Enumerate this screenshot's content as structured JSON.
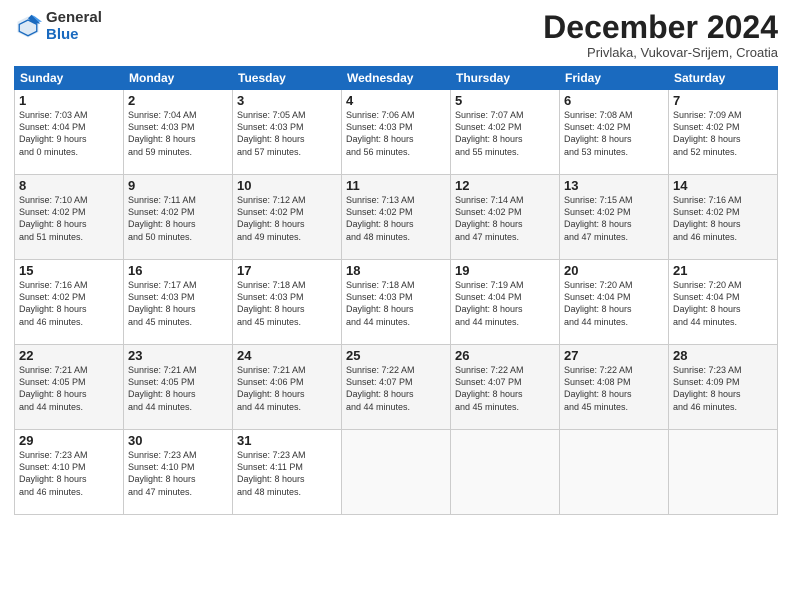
{
  "logo": {
    "general": "General",
    "blue": "Blue"
  },
  "header": {
    "title": "December 2024",
    "subtitle": "Privlaka, Vukovar-Srijem, Croatia"
  },
  "weekdays": [
    "Sunday",
    "Monday",
    "Tuesday",
    "Wednesday",
    "Thursday",
    "Friday",
    "Saturday"
  ],
  "weeks": [
    [
      {
        "day": "1",
        "info": "Sunrise: 7:03 AM\nSunset: 4:04 PM\nDaylight: 9 hours\nand 0 minutes."
      },
      {
        "day": "2",
        "info": "Sunrise: 7:04 AM\nSunset: 4:03 PM\nDaylight: 8 hours\nand 59 minutes."
      },
      {
        "day": "3",
        "info": "Sunrise: 7:05 AM\nSunset: 4:03 PM\nDaylight: 8 hours\nand 57 minutes."
      },
      {
        "day": "4",
        "info": "Sunrise: 7:06 AM\nSunset: 4:03 PM\nDaylight: 8 hours\nand 56 minutes."
      },
      {
        "day": "5",
        "info": "Sunrise: 7:07 AM\nSunset: 4:02 PM\nDaylight: 8 hours\nand 55 minutes."
      },
      {
        "day": "6",
        "info": "Sunrise: 7:08 AM\nSunset: 4:02 PM\nDaylight: 8 hours\nand 53 minutes."
      },
      {
        "day": "7",
        "info": "Sunrise: 7:09 AM\nSunset: 4:02 PM\nDaylight: 8 hours\nand 52 minutes."
      }
    ],
    [
      {
        "day": "8",
        "info": "Sunrise: 7:10 AM\nSunset: 4:02 PM\nDaylight: 8 hours\nand 51 minutes."
      },
      {
        "day": "9",
        "info": "Sunrise: 7:11 AM\nSunset: 4:02 PM\nDaylight: 8 hours\nand 50 minutes."
      },
      {
        "day": "10",
        "info": "Sunrise: 7:12 AM\nSunset: 4:02 PM\nDaylight: 8 hours\nand 49 minutes."
      },
      {
        "day": "11",
        "info": "Sunrise: 7:13 AM\nSunset: 4:02 PM\nDaylight: 8 hours\nand 48 minutes."
      },
      {
        "day": "12",
        "info": "Sunrise: 7:14 AM\nSunset: 4:02 PM\nDaylight: 8 hours\nand 47 minutes."
      },
      {
        "day": "13",
        "info": "Sunrise: 7:15 AM\nSunset: 4:02 PM\nDaylight: 8 hours\nand 47 minutes."
      },
      {
        "day": "14",
        "info": "Sunrise: 7:16 AM\nSunset: 4:02 PM\nDaylight: 8 hours\nand 46 minutes."
      }
    ],
    [
      {
        "day": "15",
        "info": "Sunrise: 7:16 AM\nSunset: 4:02 PM\nDaylight: 8 hours\nand 46 minutes."
      },
      {
        "day": "16",
        "info": "Sunrise: 7:17 AM\nSunset: 4:03 PM\nDaylight: 8 hours\nand 45 minutes."
      },
      {
        "day": "17",
        "info": "Sunrise: 7:18 AM\nSunset: 4:03 PM\nDaylight: 8 hours\nand 45 minutes."
      },
      {
        "day": "18",
        "info": "Sunrise: 7:18 AM\nSunset: 4:03 PM\nDaylight: 8 hours\nand 44 minutes."
      },
      {
        "day": "19",
        "info": "Sunrise: 7:19 AM\nSunset: 4:04 PM\nDaylight: 8 hours\nand 44 minutes."
      },
      {
        "day": "20",
        "info": "Sunrise: 7:20 AM\nSunset: 4:04 PM\nDaylight: 8 hours\nand 44 minutes."
      },
      {
        "day": "21",
        "info": "Sunrise: 7:20 AM\nSunset: 4:04 PM\nDaylight: 8 hours\nand 44 minutes."
      }
    ],
    [
      {
        "day": "22",
        "info": "Sunrise: 7:21 AM\nSunset: 4:05 PM\nDaylight: 8 hours\nand 44 minutes."
      },
      {
        "day": "23",
        "info": "Sunrise: 7:21 AM\nSunset: 4:05 PM\nDaylight: 8 hours\nand 44 minutes."
      },
      {
        "day": "24",
        "info": "Sunrise: 7:21 AM\nSunset: 4:06 PM\nDaylight: 8 hours\nand 44 minutes."
      },
      {
        "day": "25",
        "info": "Sunrise: 7:22 AM\nSunset: 4:07 PM\nDaylight: 8 hours\nand 44 minutes."
      },
      {
        "day": "26",
        "info": "Sunrise: 7:22 AM\nSunset: 4:07 PM\nDaylight: 8 hours\nand 45 minutes."
      },
      {
        "day": "27",
        "info": "Sunrise: 7:22 AM\nSunset: 4:08 PM\nDaylight: 8 hours\nand 45 minutes."
      },
      {
        "day": "28",
        "info": "Sunrise: 7:23 AM\nSunset: 4:09 PM\nDaylight: 8 hours\nand 46 minutes."
      }
    ],
    [
      {
        "day": "29",
        "info": "Sunrise: 7:23 AM\nSunset: 4:10 PM\nDaylight: 8 hours\nand 46 minutes."
      },
      {
        "day": "30",
        "info": "Sunrise: 7:23 AM\nSunset: 4:10 PM\nDaylight: 8 hours\nand 47 minutes."
      },
      {
        "day": "31",
        "info": "Sunrise: 7:23 AM\nSunset: 4:11 PM\nDaylight: 8 hours\nand 48 minutes."
      },
      {
        "day": "",
        "info": ""
      },
      {
        "day": "",
        "info": ""
      },
      {
        "day": "",
        "info": ""
      },
      {
        "day": "",
        "info": ""
      }
    ]
  ]
}
